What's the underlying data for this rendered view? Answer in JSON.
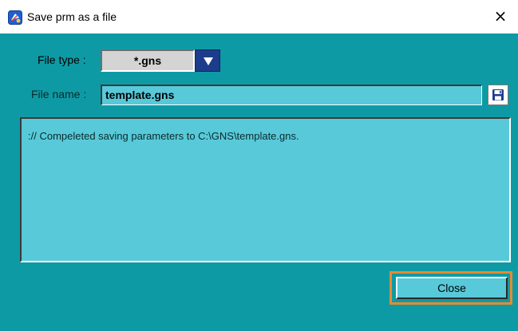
{
  "window": {
    "title": "Save prm as a file",
    "close_glyph": "×"
  },
  "form": {
    "file_type_label": "File type :",
    "file_type_value": "*.gns",
    "file_name_label": "File name :",
    "file_name_value": "template.gns"
  },
  "log": {
    "message": ":// Compeleted saving parameters to C:\\GNS\\template.gns."
  },
  "buttons": {
    "close_label": "Close"
  },
  "icons": {
    "app": "app-icon",
    "dropdown": "triangle-down-icon",
    "save": "floppy-disk-icon"
  },
  "colors": {
    "client_background": "#0e9aa4",
    "field_background": "#58c9d9",
    "dropdown_button": "#1e3c8c",
    "close_highlight": "#e98a2e"
  }
}
